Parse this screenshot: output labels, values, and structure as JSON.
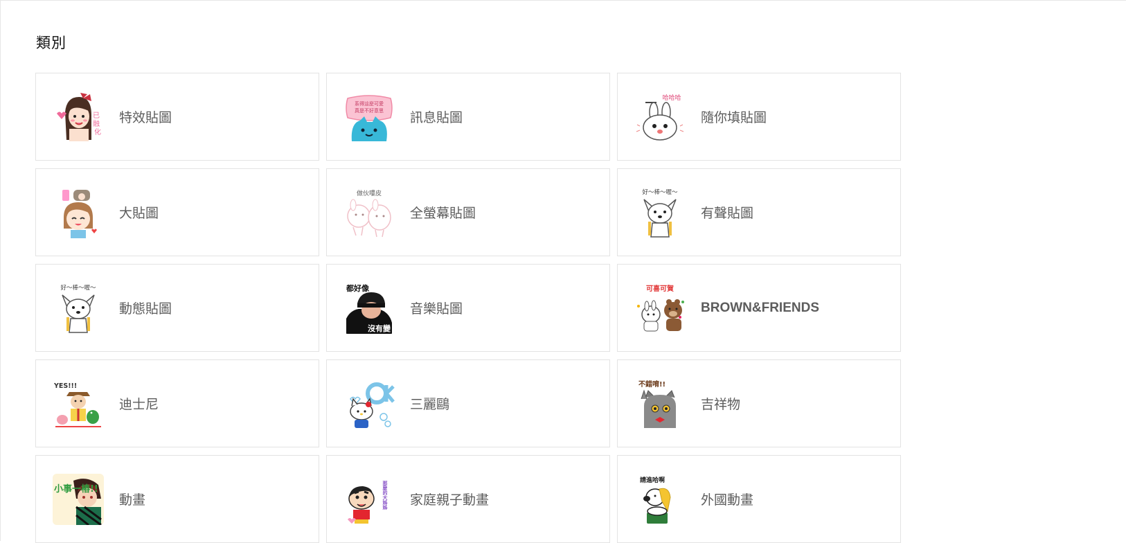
{
  "section": {
    "title": "類別"
  },
  "categories": [
    {
      "label": "特效貼圖",
      "icon": "girl-sticker-icon"
    },
    {
      "label": "訊息貼圖",
      "icon": "blue-cat-message-icon"
    },
    {
      "label": "隨你填貼圖",
      "icon": "rabbit-custom-text-icon"
    },
    {
      "label": "大貼圖",
      "icon": "big-girl-sticker-icon"
    },
    {
      "label": "全螢幕貼圖",
      "icon": "fullscreen-bunnies-icon"
    },
    {
      "label": "有聲貼圖",
      "icon": "chihuahua-sound-icon"
    },
    {
      "label": "動態貼圖",
      "icon": "chihuahua-animated-icon"
    },
    {
      "label": "音樂貼圖",
      "icon": "music-person-icon"
    },
    {
      "label": "BROWN&FRIENDS",
      "icon": "brown-bear-friends-icon"
    },
    {
      "label": "迪士尼",
      "icon": "disney-toy-icon"
    },
    {
      "label": "三麗鷗",
      "icon": "hello-kitty-icon"
    },
    {
      "label": "吉祥物",
      "icon": "gray-cat-mascot-icon"
    },
    {
      "label": "動畫",
      "icon": "anime-character-icon"
    },
    {
      "label": "家庭親子動畫",
      "icon": "family-anime-icon"
    },
    {
      "label": "外國動畫",
      "icon": "snoopy-icon"
    }
  ],
  "sticker_text": {
    "c2_line1": "系得這麼可愛",
    "c2_line2": "真是不好意思",
    "c3": "哈哈哈",
    "c5": "做伙嘍皮",
    "c6": "好～棒～喔～",
    "c7": "好～棒～喔～",
    "c8_top": "都好像",
    "c8_bottom": "沒有變",
    "c9": "可喜可賀",
    "c10": "YES!!!",
    "c12": "不錯唷!!",
    "c13": "小事一樁!!",
    "c15": "請進哈啊"
  }
}
